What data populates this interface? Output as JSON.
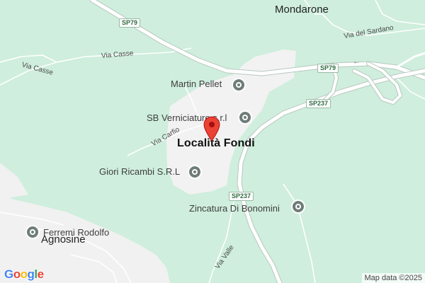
{
  "map": {
    "colors": {
      "land": "#cfeedd",
      "developed": "#f2f2f2",
      "road_major": "#ffffff",
      "road_edge": "#b8c8c0",
      "marker": "#ea4335",
      "poi_pin": "#6f7d79"
    },
    "places": {
      "mondarone": "Mondarone",
      "localita_fondi": "Località Fondi",
      "agnosine": "Agnosine"
    },
    "roads": {
      "via_casse_1": "Via Casse",
      "via_casse_2": "Via Casse",
      "via_del_sardano": "Via del Sardano",
      "via_carfio": "Via Carfio",
      "via_valle": "Via Valle"
    },
    "shields": {
      "sp79_top": "SP79",
      "sp79_right": "SP79",
      "sp237_right": "SP237",
      "sp237_mid": "SP237"
    },
    "pois": {
      "martin_pellet": "Martin Pellet",
      "sb_verniciature": "SB Verniciature s.r.l",
      "giori_ricambi": "Giori Ricambi S.R.L",
      "zincatura": "Zincatura Di Bonomini",
      "ferremi": "Ferremi Rodolfo"
    },
    "icons": {
      "main_marker": "red-location-pin-icon",
      "poi": "grey-poi-pin-icon",
      "arrow": "one-way-arrow-icon"
    },
    "logo": "Google",
    "attribution": "Map data ©2025"
  }
}
